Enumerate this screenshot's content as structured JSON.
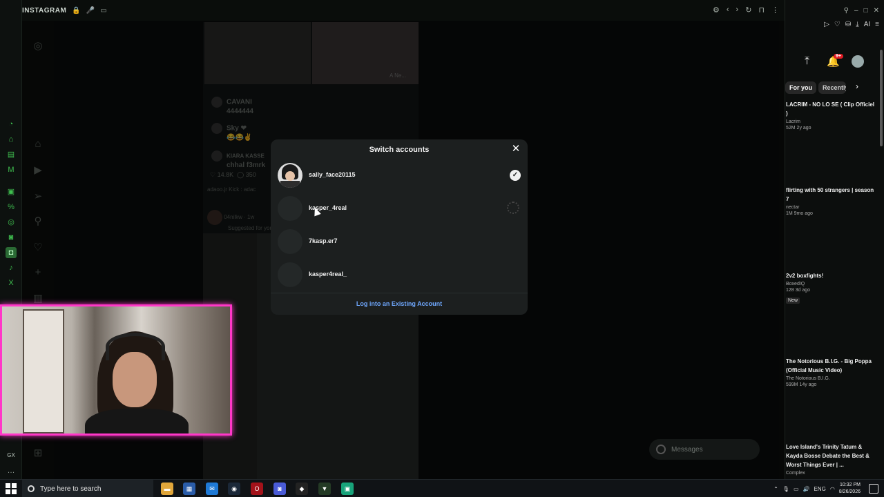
{
  "browser": {
    "tab_title": "INSTAGRAM"
  },
  "modal": {
    "title": "Switch accounts",
    "accounts": [
      {
        "username": "sally_face20115",
        "state": "active"
      },
      {
        "username": "kasper_4real",
        "state": "loading"
      },
      {
        "username": "7kasp.er7",
        "state": "inactive"
      },
      {
        "username": "kasper4real_",
        "state": "inactive"
      }
    ],
    "login_link": "Log into an Existing Account"
  },
  "feed": {
    "comments": [
      {
        "user": "CAVANI",
        "text": "4444444"
      },
      {
        "user": "Sky ❤",
        "text": "😂😂✌"
      },
      {
        "user": "KIARA KASSE",
        "text": "chhal f3mrk"
      }
    ],
    "likes": "14.8K",
    "comments_count": "350",
    "caption_user": "adaoo.jr",
    "caption_text": "Kick : adac",
    "suggested_user": "04nilkw",
    "suggested_age": "1w",
    "suggested_label": "Suggested for you",
    "thumb_label": "A Ne..."
  },
  "messages": {
    "label": "Messages"
  },
  "youtube": {
    "notification_badge": "9+",
    "chips": [
      "For you",
      "Recently"
    ],
    "videos": [
      {
        "title": "LACRIM - NO LO SE ( Clip Officiel )",
        "channel": "Lacrim",
        "meta": "52M  2y ago",
        "badge": ""
      },
      {
        "title": "flirting with 50 strangers | season 7",
        "channel": "nectar",
        "meta": "1M  9mo ago",
        "badge": ""
      },
      {
        "title": "2v2 boxfights!",
        "channel": "BoxedIQ",
        "meta": "128  3d ago",
        "badge": "New"
      },
      {
        "title": "The Notorious B.I.G. - Big Poppa (Official Music Video)",
        "channel": "The Notorious B.I.G.",
        "meta": "599M  14y ago",
        "badge": ""
      },
      {
        "title": "Love Island's Trinity Tatum & Kayda Bosse Debate the Best & Worst Things Ever | ...",
        "channel": "Complex",
        "meta": "",
        "badge": ""
      }
    ]
  },
  "taskbar": {
    "search_placeholder": "Type here to search",
    "language": "ENG",
    "time": "10:32 PM",
    "date": "8/26/2026"
  },
  "colors": {
    "gx_accent": "#3fbf4f",
    "cam_border": "#ff37c8",
    "link_blue": "#6fa8ff",
    "badge_red": "#e01b24"
  }
}
